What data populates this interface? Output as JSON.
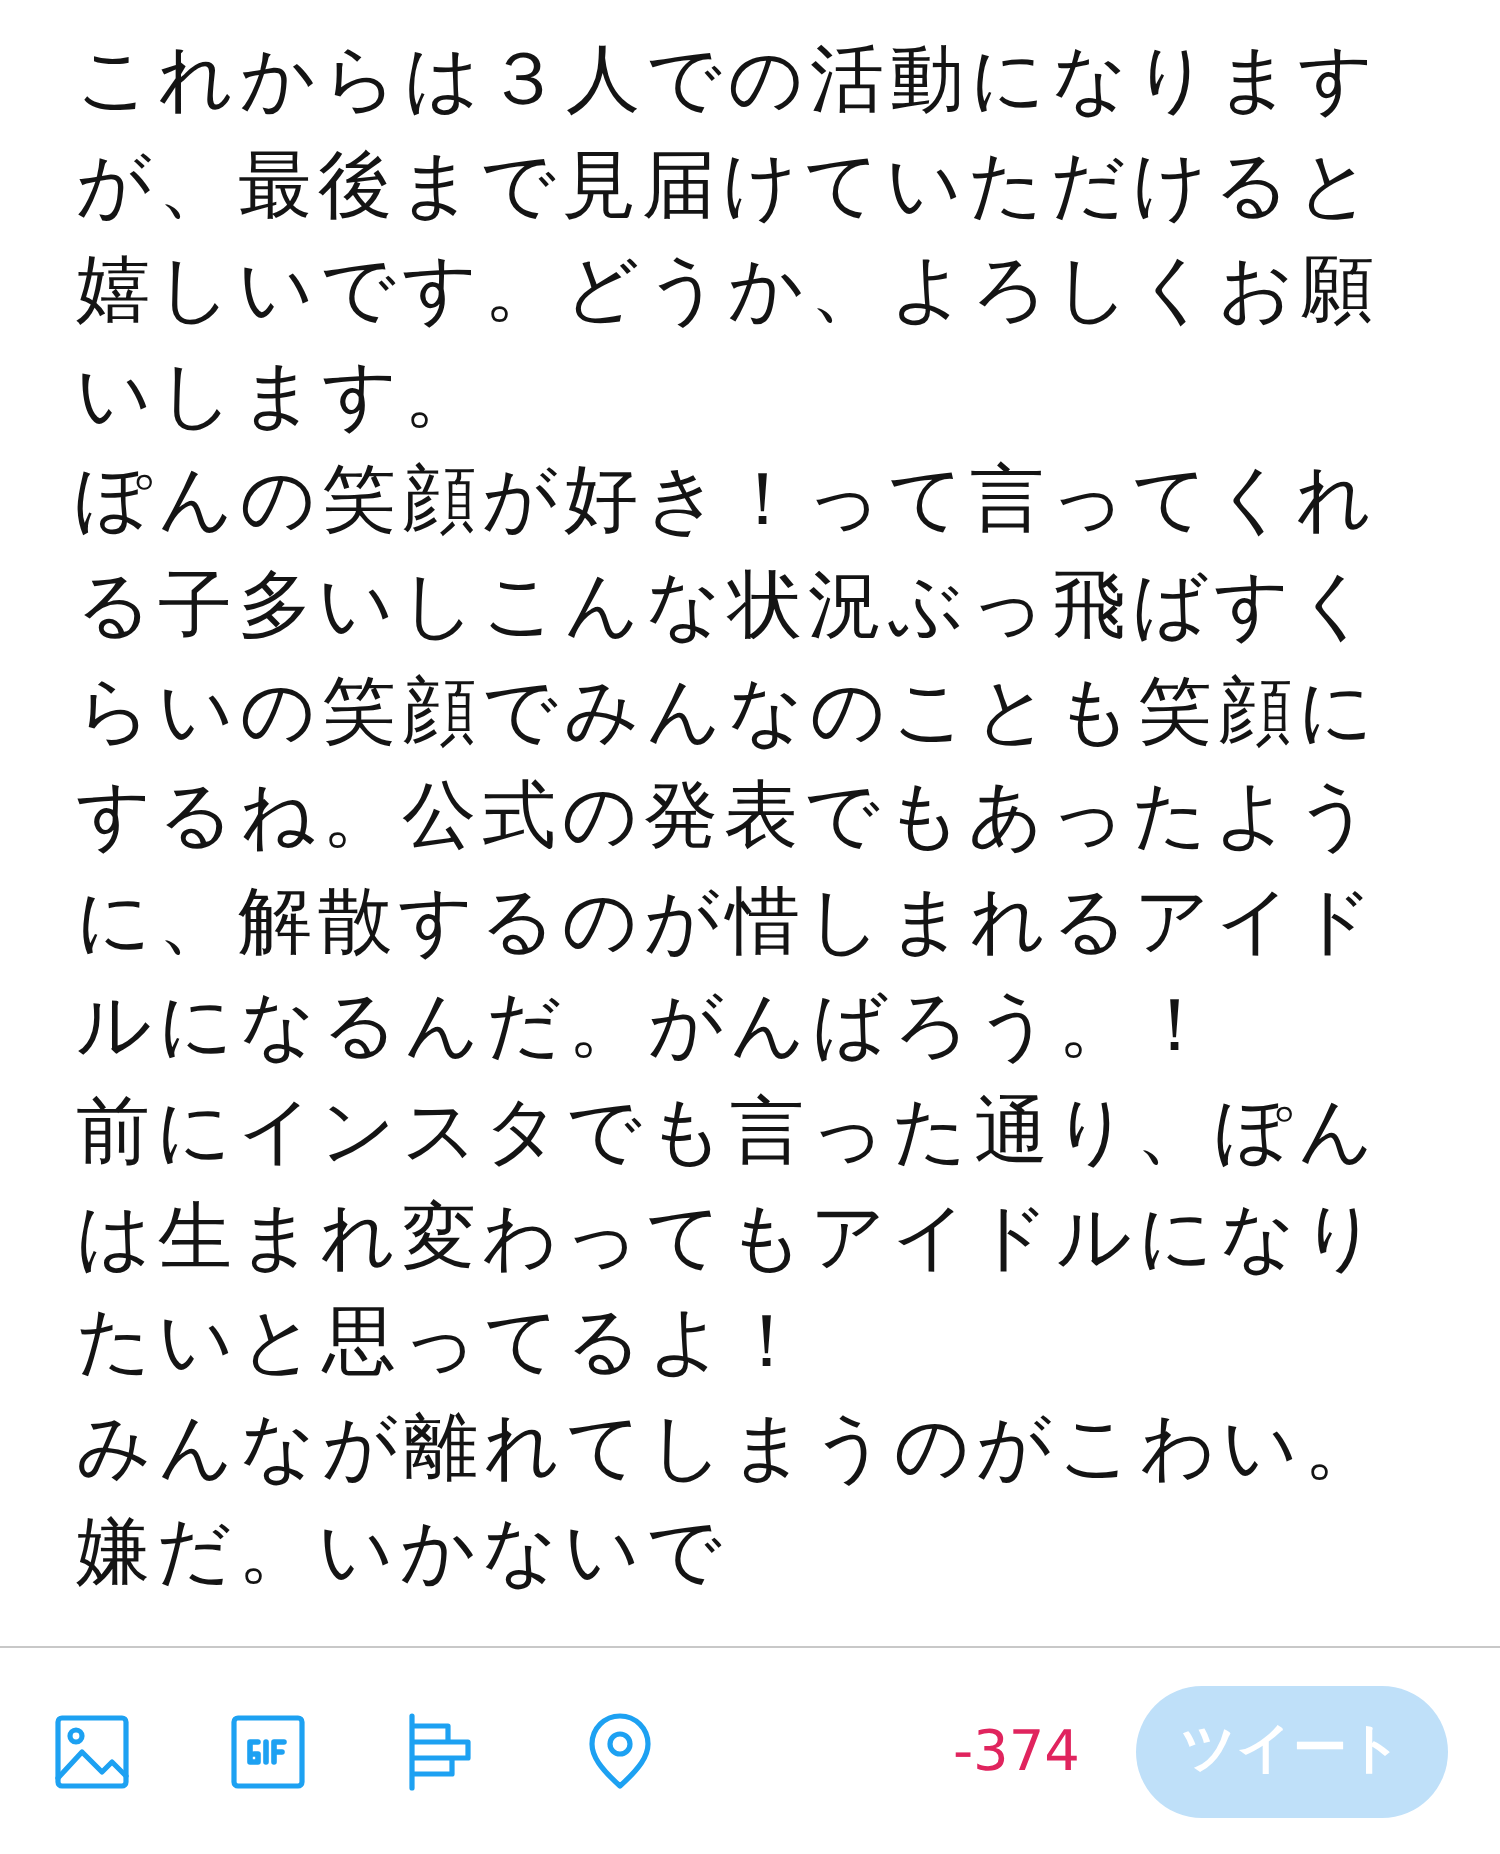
{
  "body_lines": [
    "これからは３人での活動になります",
    "が、最後まで見届けていただけると",
    "嬉しいです。どうか、よろしくお願",
    "いします。",
    "ぽんの笑顔が好き！って言ってくれ",
    "る子多いしこんな状況ぶっ飛ばすく",
    "らいの笑顔でみんなのことも笑顔に",
    "するね。公式の発表でもあったよう",
    "に、解散するのが惜しまれるアイド",
    "ルになるんだ。がんばろう。！",
    "前にインスタでも言った通り、ぽん",
    "は生まれ変わってもアイドルになり",
    "たいと思ってるよ！",
    "みんなが離れてしまうのがこわい。",
    "嫌だ。いかないで"
  ],
  "toolbar": {
    "character_count": "-374",
    "tweet_button": {
      "label": "ツイート",
      "disabled": true
    }
  }
}
